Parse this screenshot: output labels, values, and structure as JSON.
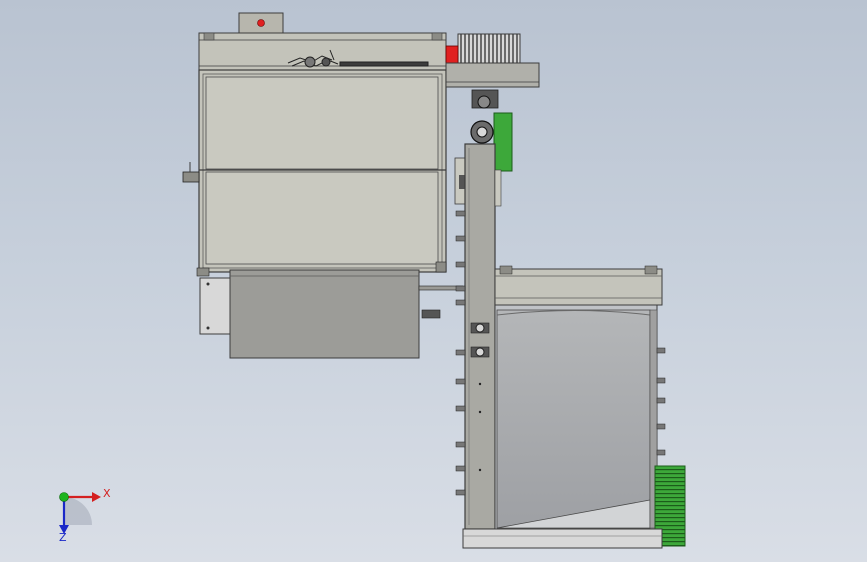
{
  "triad": {
    "x_label": "X",
    "z_label": "Z"
  },
  "colors": {
    "background_top": "#b9c3d1",
    "panel_fill": "#c9c9c0",
    "frame": "#3c3c3c",
    "column_fill": "#a9a9a3",
    "dark_panel": "#9a9a96",
    "accent_green": "#3da83a",
    "accent_red": "#e02020",
    "axis_x": "#d42020",
    "axis_y": "#1eb41e",
    "axis_z": "#1a28c8"
  }
}
